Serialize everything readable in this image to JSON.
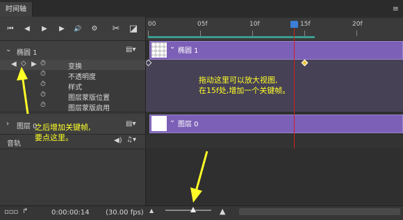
{
  "panel": {
    "title": "时间轴"
  },
  "toolbar": {
    "first_frame": "⏮",
    "prev_frame": "◀",
    "play": "▶",
    "next_frame": "▶",
    "audio": "🔊",
    "settings": "⚙",
    "split": "✂",
    "transition": "◪"
  },
  "ruler": {
    "labels": [
      "00",
      "05f",
      "10f",
      "15f",
      "20f"
    ]
  },
  "layers": {
    "ellipse": {
      "name": "椭圆 1",
      "clip_name": "椭圆 1"
    },
    "props": [
      "变换",
      "不透明度",
      "样式",
      "图层蒙版位置",
      "图层蒙版启用"
    ],
    "layer0": {
      "name": "图层 0",
      "clip_name": "图层 0"
    },
    "audio": {
      "name": "音轨"
    }
  },
  "status": {
    "timecode": "0:00:00:14",
    "fps": "(30.00 fps)"
  },
  "annotations": {
    "drag_note_line1": "拖动这里可以放大视图,",
    "drag_note_line2": "在15f处,增加一个关键帧。",
    "key_note_line1": "之后增加关键帧,",
    "key_note_line2": "要点这里。"
  },
  "colors": {
    "accent": "#ffff28",
    "clip": "#7c5fb6",
    "playhead": "#cc2222",
    "playhead_handle": "#3b7fd9"
  }
}
